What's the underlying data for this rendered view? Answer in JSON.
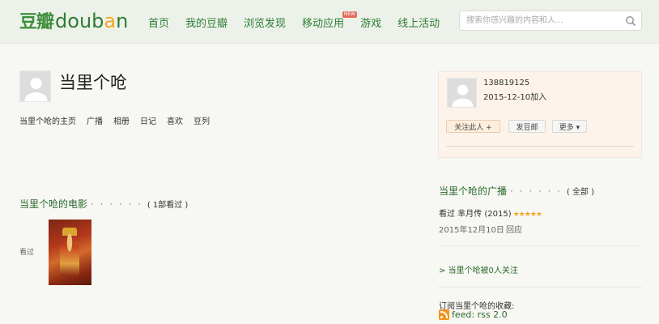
{
  "header": {
    "logo_cn": "豆瓣",
    "logo_en": {
      "d": "d",
      "o": "o",
      "u": "u",
      "b": "b",
      "a": "a",
      "n": "n"
    },
    "nav": [
      {
        "label": "首页"
      },
      {
        "label": "我的豆瓣"
      },
      {
        "label": "浏览发现"
      },
      {
        "label": "移动应用",
        "badge": "NEW"
      },
      {
        "label": "游戏"
      },
      {
        "label": "线上活动"
      }
    ],
    "search_placeholder": "搜索你感兴趣的内容和人..."
  },
  "profile": {
    "name": "当里个呛",
    "nav": [
      "当里个呛的主页",
      "广播",
      "相册",
      "日记",
      "喜欢",
      "豆列"
    ]
  },
  "movies": {
    "title": "当里个呛的电影",
    "dots": "· · · · · ·",
    "count": "( 1部看过 )",
    "seen_label": "看过"
  },
  "sidebar": {
    "uid": "138819125",
    "joined": "2015-12-10加入",
    "buttons": {
      "follow": "关注此人 +",
      "doumail": "发豆邮",
      "more": "更多 ▾"
    },
    "broadcast_title": "当里个呛的广播",
    "broadcast_dots": "· · · · · ·",
    "broadcast_all": "( 全部 )",
    "broadcast_item": "看过 芈月传 (2015)",
    "broadcast_stars": "★★★★★",
    "broadcast_date": "2015年12月10日",
    "broadcast_reply": "回应",
    "followed_by": "> 当里个呛被0人关注",
    "subscribe": "订阅当里个呛的收藏:",
    "rss": "feed: rss 2.0"
  },
  "colors": {
    "brand_green": "#2f7d34",
    "header_bg": "#ecf2ea",
    "star": "#f5a623",
    "rss": "#f7941d"
  }
}
